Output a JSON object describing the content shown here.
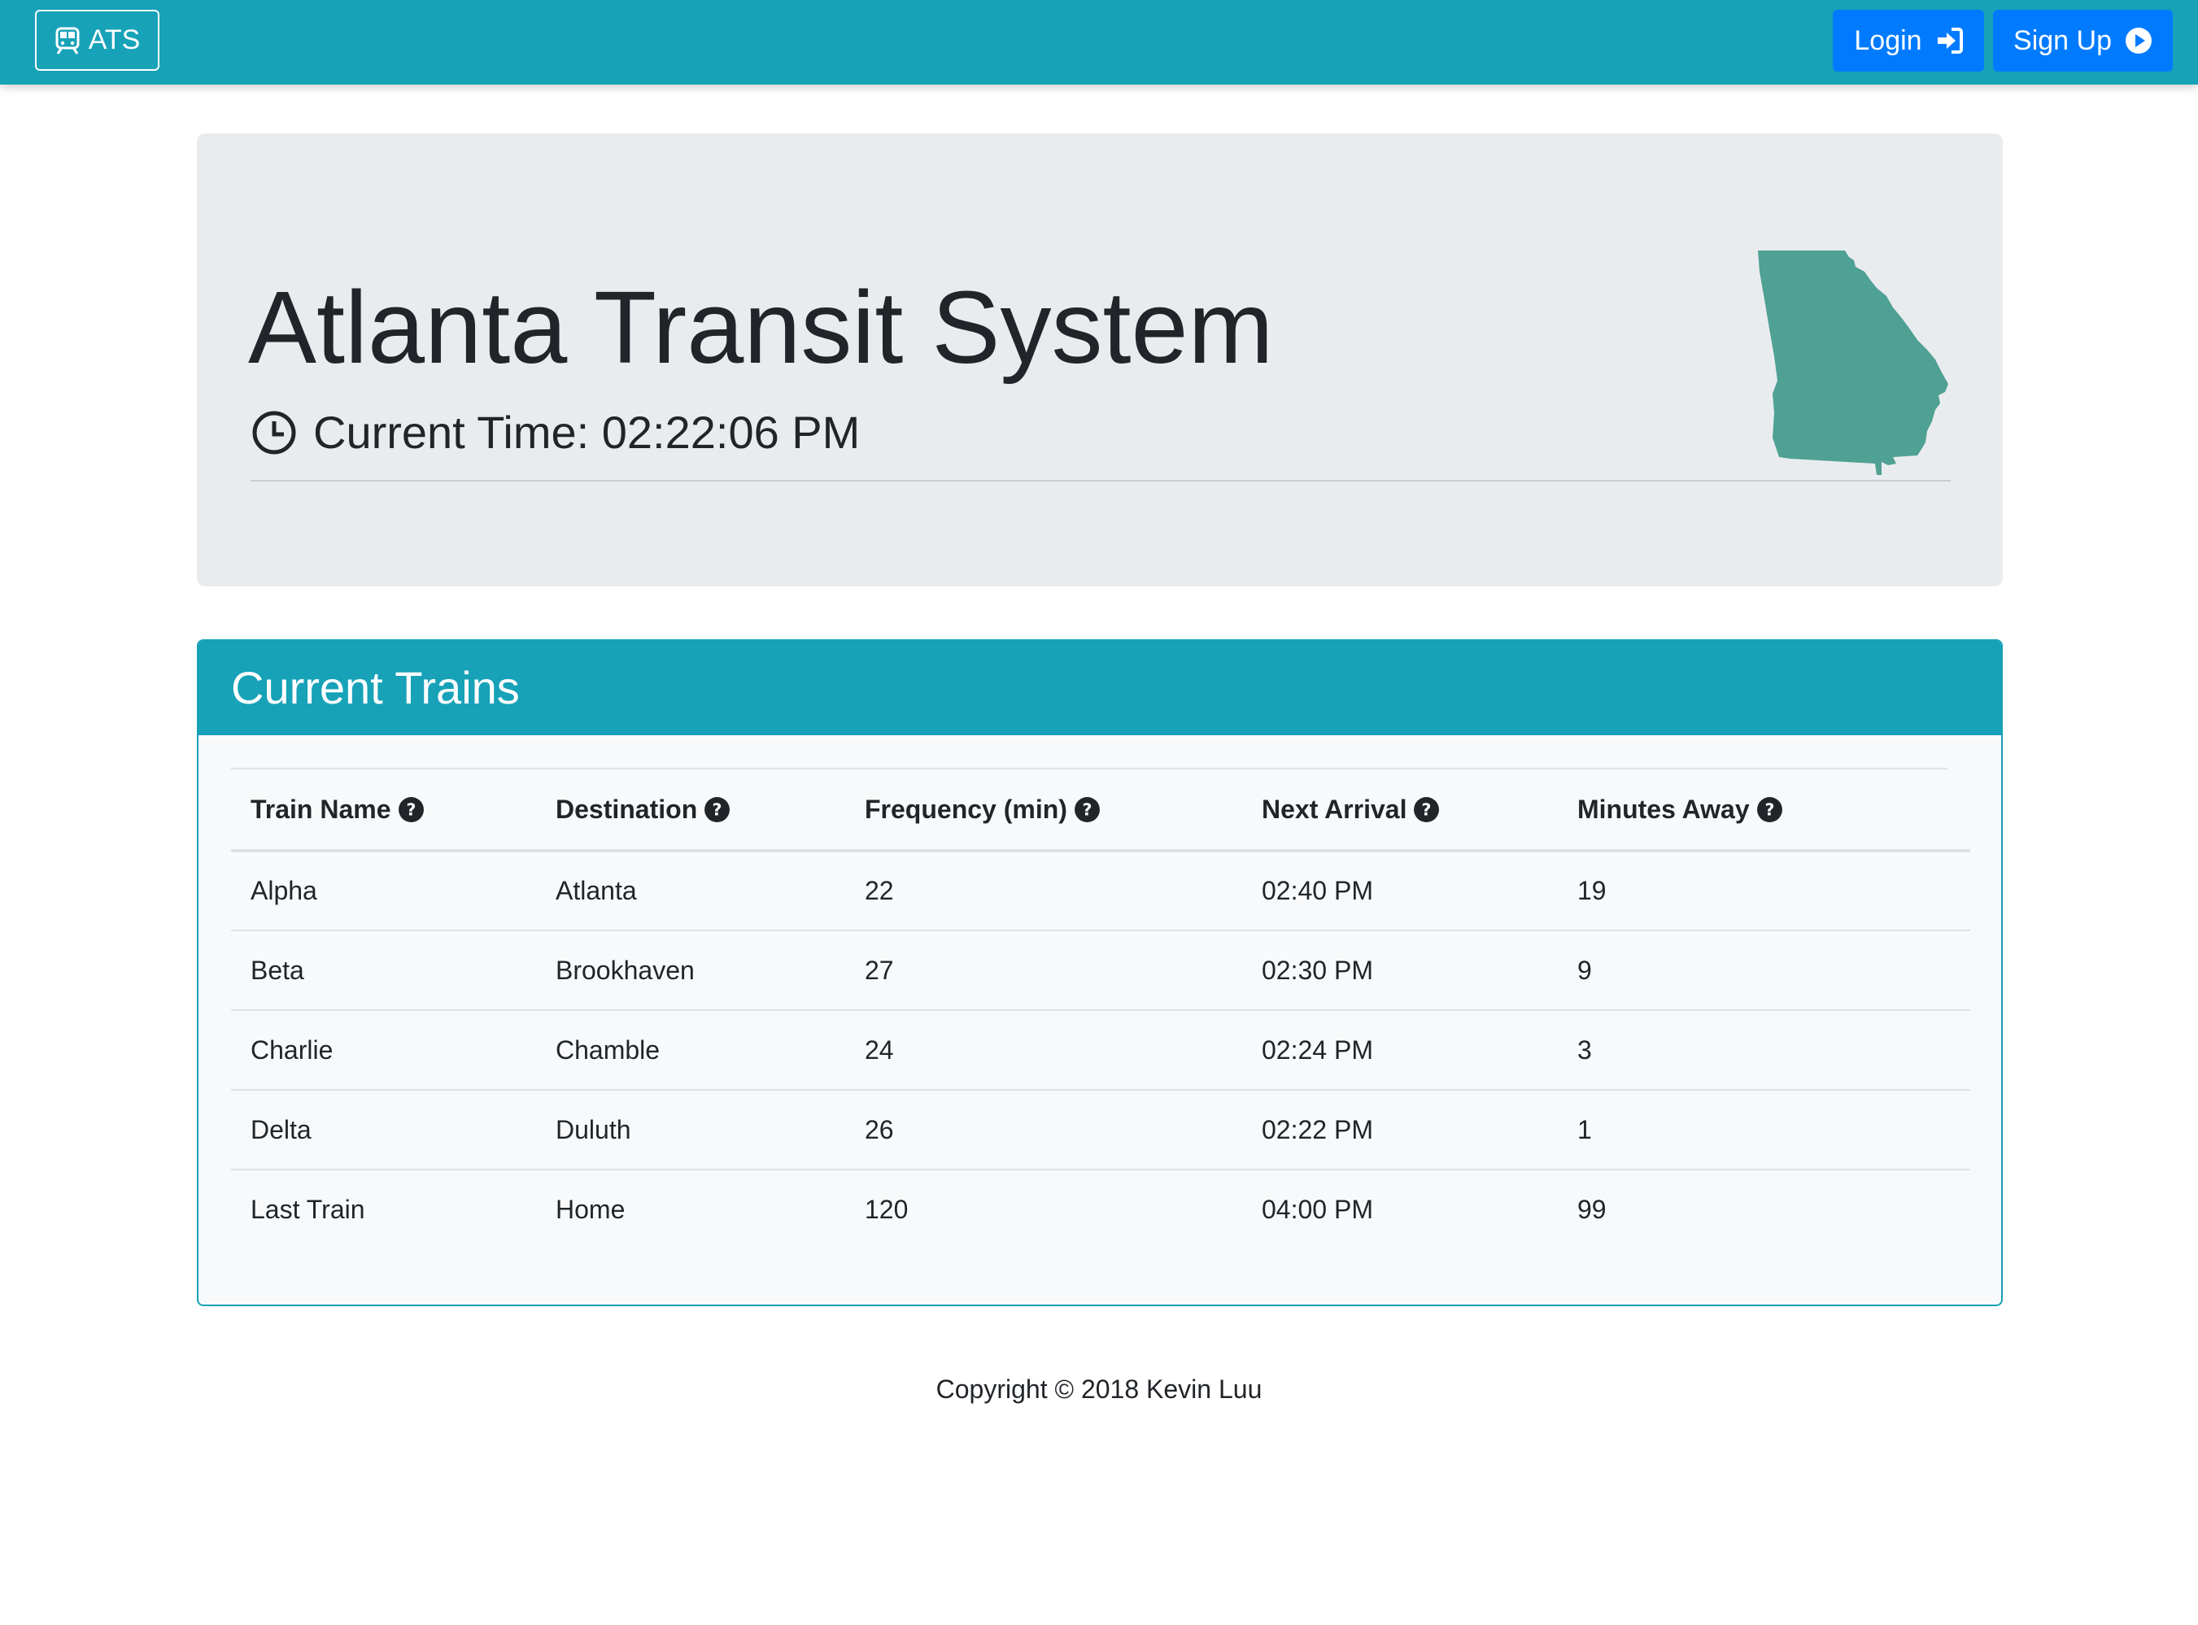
{
  "navbar": {
    "brand_label": "ATS",
    "brand_icon": "train-icon",
    "login_label": "Login",
    "login_icon": "sign-in-icon",
    "signup_label": "Sign Up",
    "signup_icon": "play-circle-icon",
    "bg_color": "#17a2b8",
    "button_color": "#007bff"
  },
  "hero": {
    "title": "Atlanta Transit System",
    "time_label": "Current Time: 02:22:06 PM",
    "clock_icon": "clock-icon",
    "map_icon": "georgia-state-map",
    "map_color": "#4fa193"
  },
  "trains_card": {
    "title": "Current Trains",
    "columns": [
      "Train Name",
      "Destination",
      "Frequency (min)",
      "Next Arrival",
      "Minutes Away"
    ],
    "rows": [
      [
        "Alpha",
        "Atlanta",
        "22",
        "02:40 PM",
        "19"
      ],
      [
        "Beta",
        "Brookhaven",
        "27",
        "02:30 PM",
        "9"
      ],
      [
        "Charlie",
        "Chamble",
        "24",
        "02:24 PM",
        "3"
      ],
      [
        "Delta",
        "Duluth",
        "26",
        "02:22 PM",
        "1"
      ],
      [
        "Last Train",
        "Home",
        "120",
        "04:00 PM",
        "99"
      ]
    ]
  },
  "footer": {
    "text": "Copyright © 2018 Kevin Luu"
  }
}
